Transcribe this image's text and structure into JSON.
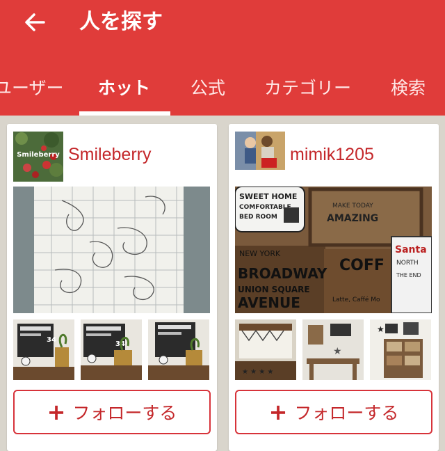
{
  "header": {
    "title": "人を探す",
    "back_icon": "arrow-left-icon"
  },
  "tabs": [
    {
      "label": "ユーザー",
      "active": false
    },
    {
      "label": "ホット",
      "active": true
    },
    {
      "label": "公式",
      "active": false
    },
    {
      "label": "カテゴリー",
      "active": false
    },
    {
      "label": "検索",
      "active": false
    }
  ],
  "cards": [
    {
      "username": "Smileberry",
      "avatar_text": "Smileberry",
      "thumb_texts": [
        "34",
        "34"
      ],
      "follow_label": "フォローする"
    },
    {
      "username": "mimik1205",
      "photo_texts": {
        "sweet_home": "SWEET HOME",
        "comfortable": "COMFORTABLE",
        "bed_room": "BED ROOM",
        "make_today": "MAKE TODAY",
        "amazing": "AMAZING",
        "broadway": "BROADWAY",
        "union_square": "UNION SQUARE",
        "avenue": "AVENUE",
        "new_york": "NEW YORK",
        "coffee": "COFF",
        "latte": "Latte, Caffé Mo",
        "santa": "Santa",
        "north": "NORTH",
        "the_end": "THE END"
      },
      "follow_label": "フォローする"
    }
  ],
  "colors": {
    "brand": "#e03c3a",
    "accent": "#c4272a",
    "background": "#d9d5cc"
  }
}
